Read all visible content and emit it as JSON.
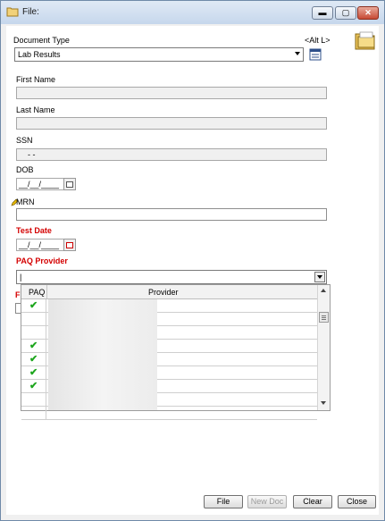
{
  "window": {
    "title": "File:"
  },
  "form": {
    "document_type_label": "Document Type",
    "alt_hint": "<Alt L>",
    "document_type_value": "Lab Results",
    "first_name_label": "First Name",
    "last_name_label": "Last Name",
    "ssn_label": "SSN",
    "ssn_value": "-  -",
    "dob_label": "DOB",
    "dob_value": "__/__/____",
    "mrn_label": "MRN",
    "test_date_label": "Test Date",
    "test_date_value": "__/__/____",
    "paq_provider_label": "PAQ Provider",
    "paq_provider_value": "|",
    "truncated_label_char": "F"
  },
  "grid": {
    "columns": [
      "PAQ",
      "Provider"
    ],
    "rows": [
      {
        "paq": true
      },
      {
        "paq": false
      },
      {
        "paq": false
      },
      {
        "paq": true
      },
      {
        "paq": true
      },
      {
        "paq": true
      },
      {
        "paq": true
      },
      {
        "paq": false
      },
      {
        "paq": false
      }
    ]
  },
  "buttons": {
    "file": "File",
    "new_doc": "New Doc",
    "clear": "Clear",
    "close": "Close"
  },
  "icons": {
    "check_glyph": "✔",
    "minimize": "▬",
    "maximize": "▢",
    "close": "✕"
  }
}
